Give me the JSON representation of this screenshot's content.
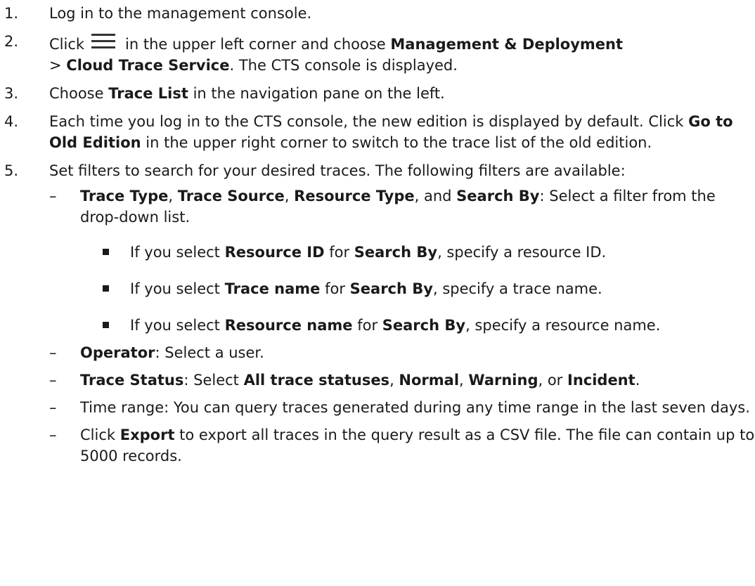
{
  "steps": [
    {
      "num": "1.",
      "text": "Log in to the management console."
    },
    {
      "num": "2.",
      "a": "Click",
      "icon": "menu-icon",
      "b": "in the upper left corner and choose",
      "bold1": "Management & Deployment",
      "c": ">",
      "bold2": "Cloud Trace Service",
      "d": ". The CTS console is displayed."
    },
    {
      "num": "3.",
      "a": "Choose",
      "bold1": "Trace List",
      "b": "in the navigation pane on the left."
    },
    {
      "num": "4.",
      "a": "Each time you log in to the CTS console, the new edition is displayed by default. Click",
      "bold1": "Go to Old Edition",
      "b": "in the upper right corner to switch to the trace list of the old edition."
    },
    {
      "num": "5.",
      "text": "Set filters to search for your desired traces. The following filters are available:"
    }
  ],
  "filters": {
    "dash": "–",
    "f1": {
      "b1": "Trace Type",
      "s1": ", ",
      "b2": "Trace Source",
      "s2": ", ",
      "b3": "Resource Type",
      "s3": ", and ",
      "b4": "Search By",
      "s4": ": Select a filter from the drop-down list."
    },
    "sub_items": [
      {
        "a": "If you select",
        "b1": "Resource ID",
        "m": "for",
        "b2": "Search By",
        "z": ", specify a resource ID."
      },
      {
        "a": "If you select",
        "b1": "Trace name",
        "m": "for",
        "b2": "Search By",
        "z": ", specify a trace name."
      },
      {
        "a": "If you select",
        "b1": "Resource name",
        "m": "for",
        "b2": "Search By",
        "z": ", specify a resource name."
      }
    ],
    "f2": {
      "b1": "Operator",
      "t": ": Select a user."
    },
    "f3": {
      "b1": "Trace Status",
      "t1": ": Select ",
      "b2": "All trace statuses",
      "t2": ", ",
      "b3": "Normal",
      "t3": ", ",
      "b4": "Warning",
      "t4": ", or ",
      "b5": "Incident",
      "t5": "."
    },
    "f4": {
      "t": "Time range: You can query traces generated during any time range in the last seven days."
    },
    "f5": {
      "a": "Click",
      "b1": "Export",
      "t": "to export all traces in the query result as a CSV file. The file can contain up to 5000 records."
    }
  }
}
